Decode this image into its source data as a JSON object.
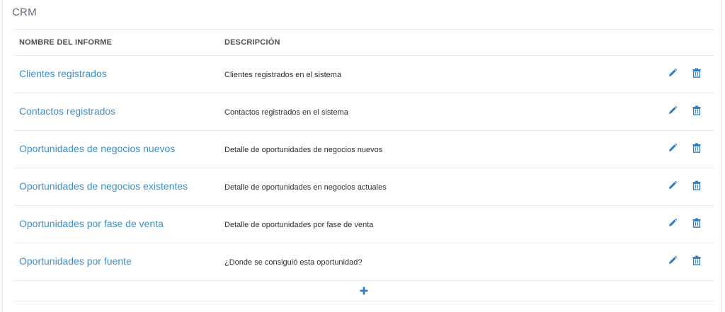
{
  "section": {
    "title": "CRM"
  },
  "table": {
    "headers": {
      "name": "NOMBRE DEL INFORME",
      "description": "DESCRIPCIÓN"
    },
    "rows": [
      {
        "name": "Clientes registrados",
        "description": "Clientes registrados en el sistema"
      },
      {
        "name": "Contactos registrados",
        "description": "Contactos registrados en el sistema"
      },
      {
        "name": "Oportunidades de negocios nuevos",
        "description": "Detalle de oportunidades de negocios nuevos"
      },
      {
        "name": "Oportunidades de negocios existentes",
        "description": "Detalle de oportunidades en negocios actuales"
      },
      {
        "name": "Oportunidades por fase de venta",
        "description": "Detalle de oportunidades por fase de venta"
      },
      {
        "name": "Oportunidades por fuente",
        "description": "¿Donde se consiguió esta oportunidad?"
      }
    ]
  },
  "icons": {
    "edit": "pencil-icon",
    "delete": "trash-icon",
    "add": "plus-icon"
  },
  "colors": {
    "link": "#3d8fc9",
    "icon": "#2f7fc1",
    "border": "#e6e9ee"
  }
}
